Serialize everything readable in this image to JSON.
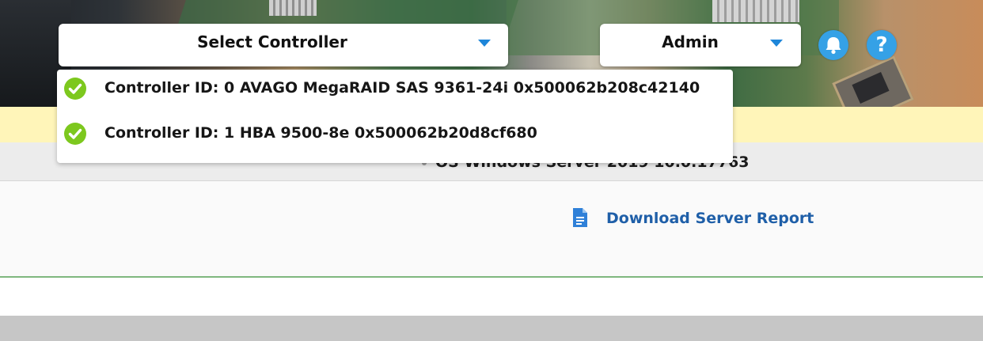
{
  "header": {
    "controller_select": {
      "label": "Select Controller"
    },
    "user_select": {
      "label": "Admin"
    },
    "icons": [
      "bell-icon",
      "help-icon"
    ],
    "help_glyph": "?"
  },
  "dropdown": {
    "items": [
      {
        "label": "Controller ID: 0 AVAGO MegaRAID SAS 9361-24i 0x500062b208c42140",
        "status_icon": "check-circle-icon"
      },
      {
        "label": "Controller ID: 1 HBA 9500-8e 0x500062b20d8cf680",
        "status_icon": "check-circle-icon"
      }
    ]
  },
  "info_bar": {
    "os_text": "OS Windows Server 2019 10.0.17763"
  },
  "content": {
    "report_link_label": "Download Server Report",
    "report_icon": "document-icon"
  },
  "colors": {
    "accent_blue": "#1e86d9",
    "status_green": "#7dc81e",
    "notice_yellow": "#fff5b9",
    "link_blue": "#1f5fa8"
  }
}
